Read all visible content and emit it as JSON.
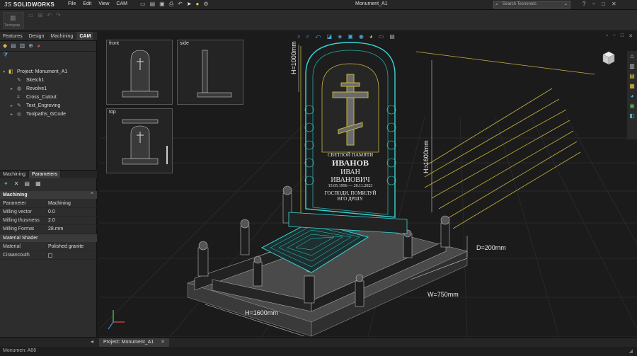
{
  "app": {
    "logo_brand": "3S",
    "logo_name": "SOLIDWORKS",
    "title": "Monument_A1",
    "menu": [
      "File",
      "Edit",
      "View",
      "CAM"
    ],
    "search_placeholder": "Search Tesnonets",
    "accent": "#4aa3df"
  },
  "cmdbar": {
    "group_label": "Tantograp"
  },
  "tabs": [
    "Features",
    "Design",
    "Machining",
    "CAM"
  ],
  "tree": {
    "project_label": "Project: Monument_A1",
    "items": [
      "Sketch1",
      "Revolve1",
      "Cross_Cutout",
      "Text_Engreving",
      "Toolpaths_GCode"
    ]
  },
  "subtabs": [
    "Machining",
    "Parameters"
  ],
  "properties": {
    "section_machining": "Machining",
    "rows": [
      {
        "k": "Parameter",
        "v": "Machining"
      },
      {
        "k": "Milling vector",
        "v": "0.0"
      },
      {
        "k": "Milling thusmess",
        "v": "2.0"
      },
      {
        "k": "Milling Format",
        "v": "28.mm"
      }
    ],
    "section_shader": "Material Shader",
    "material_key": "Material",
    "material_value": "Polished granite",
    "ciraancouth_key": "Ciraancouth"
  },
  "views": {
    "front": "front",
    "side": "side",
    "top": "top"
  },
  "monument": {
    "line1": "СВЕТЛОЙ ПАМЯТИ",
    "line2": "ИВАНОВ",
    "line3": "ИВАН",
    "line4": "ИВАНОВИЧ",
    "dates": "15.05.1956 — 20.11.2023",
    "prayer1": "ГОСПОДИ, ПОМИЛУЙ",
    "prayer2": "ВГО ДРШУ."
  },
  "dimensions": {
    "h_top": "H=1000mm",
    "h_side": "H=1600mm",
    "depth": "D=200mm",
    "width": "W=750mm",
    "length": "H=1600mm"
  },
  "bottom": {
    "doc_tab": "Project: Monument_A1"
  },
  "status": {
    "text": "Monumen: A66"
  }
}
